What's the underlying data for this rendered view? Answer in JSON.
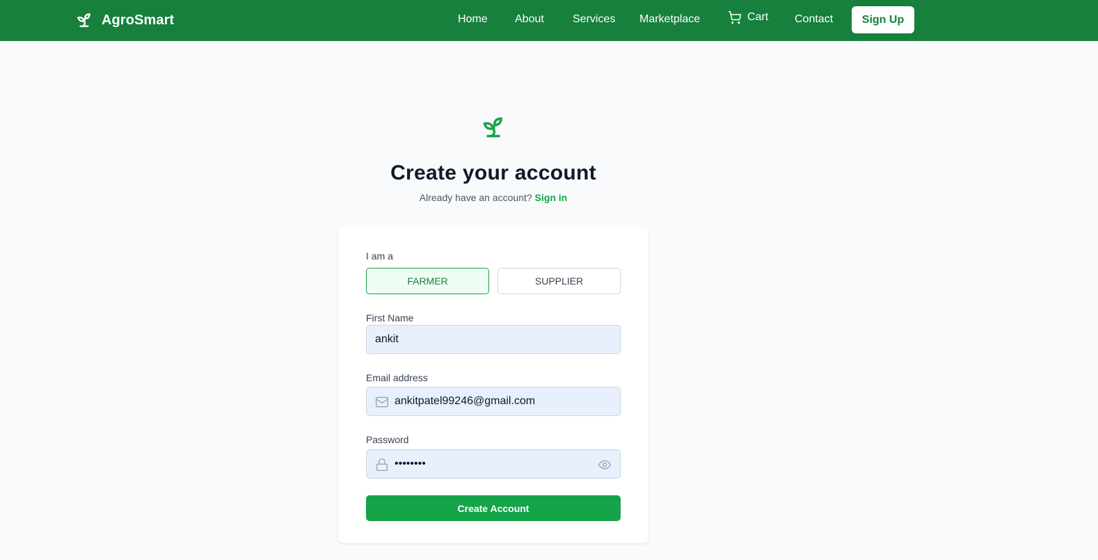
{
  "nav": {
    "brand": "AgroSmart",
    "links": [
      "Home",
      "About",
      "Services",
      "Marketplace"
    ],
    "cart": "Cart",
    "contact": "Contact",
    "signup": "Sign Up"
  },
  "page": {
    "title": "Create your account",
    "subtitle_prefix": "Already have an account?",
    "signin_link": "Sign in"
  },
  "form": {
    "role_label": "I am a",
    "roles": [
      "FARMER",
      "SUPPLIER"
    ],
    "selected_role": "FARMER",
    "first_name_label": "First Name",
    "first_name_value": "ankit",
    "email_label": "Email address",
    "email_value": "ankitpatel99246@gmail.com",
    "password_label": "Password",
    "password_value": "••••••••",
    "submit_label": "Create Account"
  },
  "colors": {
    "nav_bg": "#17803d",
    "accent": "#16a34a",
    "input_bg": "#e8f0fe",
    "page_bg": "#f8fafc"
  },
  "icons": [
    "sprout-icon",
    "cart-icon",
    "mail-icon",
    "lock-icon",
    "eye-icon"
  ]
}
